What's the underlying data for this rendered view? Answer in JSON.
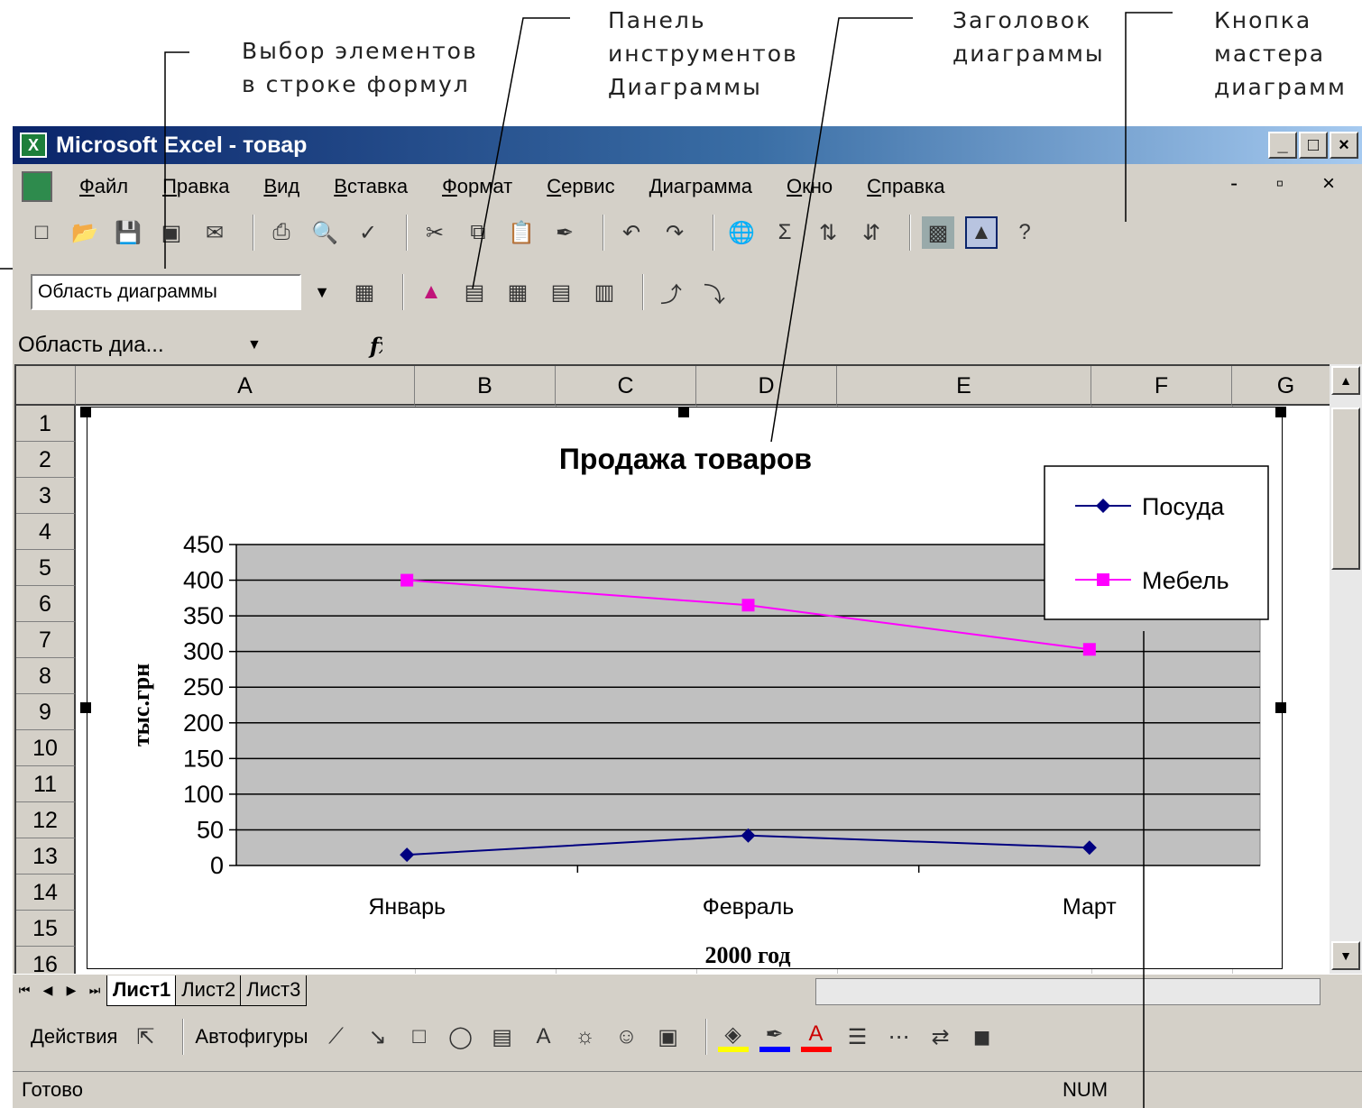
{
  "callouts": {
    "formula_select": "Выбор элементов\nв строке формул",
    "chart_toolbar": "Панель\nинструментов\nДиаграммы",
    "chart_title": "Заголовок\nдиаграммы",
    "wizard_button": "Кнопка\nмастера\nдиаграмм"
  },
  "window": {
    "title": "Microsoft Excel - товар",
    "controls": [
      "_",
      "□",
      "×"
    ]
  },
  "menu": {
    "items": [
      "Файл",
      "Правка",
      "Вид",
      "Вставка",
      "Формат",
      "Сервис",
      "Диаграмма",
      "Окно",
      "Справка"
    ],
    "right_controls": "- ▫ ×"
  },
  "chart_toolbar": {
    "object_select": "Область диаграммы"
  },
  "formula_bar": {
    "name_box": "Область диа...",
    "fx": "fx"
  },
  "grid": {
    "columns": [
      "A",
      "B",
      "C",
      "D",
      "E",
      "F",
      "G"
    ],
    "rows": [
      "1",
      "2",
      "3",
      "4",
      "5",
      "6",
      "7",
      "8",
      "9",
      "10",
      "11",
      "12",
      "13",
      "14",
      "15",
      "16"
    ]
  },
  "chart_data": {
    "type": "line",
    "title": "Продажа товаров",
    "xlabel": "2000 год",
    "ylabel": "тыс.грн",
    "categories": [
      "Январь",
      "Февраль",
      "Март"
    ],
    "ylim": [
      0,
      450
    ],
    "yticks": [
      0,
      50,
      100,
      150,
      200,
      250,
      300,
      350,
      400,
      450
    ],
    "grid": true,
    "plot_background": "#c0c0c0",
    "legend": "top-right",
    "series": [
      {
        "name": "Посуда",
        "values": [
          15,
          42,
          25
        ],
        "color": "#000080",
        "marker": "diamond"
      },
      {
        "name": "Мебель",
        "values": [
          400,
          365,
          303
        ],
        "color": "#ff00ff",
        "marker": "square"
      }
    ]
  },
  "tabs": {
    "sheets": [
      "Лист1",
      "Лист2",
      "Лист3"
    ],
    "active": "Лист1"
  },
  "drawing": {
    "actions": "Действия",
    "autoshapes": "Автофигуры"
  },
  "status": {
    "ready": "Готово",
    "num": "NUM"
  }
}
